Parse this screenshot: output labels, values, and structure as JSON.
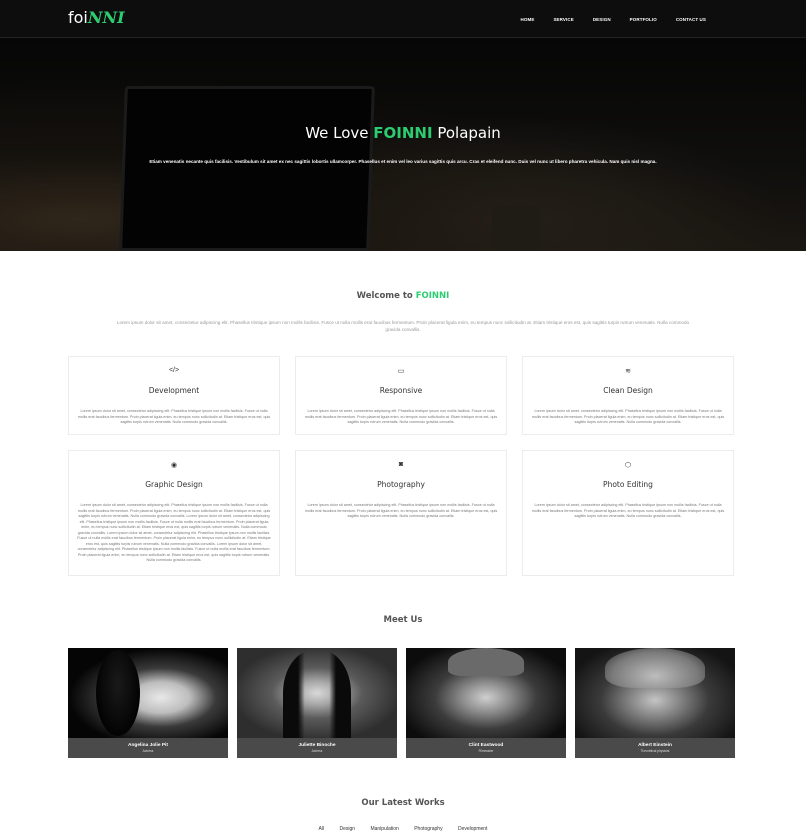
{
  "nav": {
    "logo_text": "foi",
    "logo_accent": "NNI",
    "items": [
      "HOME",
      "SERVICE",
      "DESIGN",
      "PORTFOLIO",
      "CONTACT US"
    ]
  },
  "hero": {
    "title_prefix": "We Love ",
    "title_brand": "FOINNI",
    "title_suffix": " Polapain",
    "subtitle": "Etiam venenatis necante quis facilisis. Vestibulum sit amet ex nec sagittis lobortis ullamcorper. Phasellus et enim vel leo varius sagittis quis arcu. Cras et eleifend nunc. Duis vel nunc ut libero pharetra vehicula. Nam quis nisl magna."
  },
  "welcome": {
    "title_prefix": "Welcome to ",
    "title_brand": "FOINNI",
    "text": "Lorem ipsum dolor sit amet, consectetur adipiscing elit. Phasellus tristique ipsum non mollis facilisis. Fusce ut nulla mollis erat faucibus fermentum. Proin placerat ligula enim, eu tempus nunc sollicitudin at. Etiam tristique eros est, quis sagittis turpis rutrum venenatis. Nulla commodo gravida convallis."
  },
  "services": [
    {
      "icon": "code-icon",
      "glyph": "</>",
      "title": "Development",
      "body": "Lorem ipsum dolor sit amet, consectetur adipiscing elit. Phasellus tristique ipsum non mollis facilisis. Fusce ut nulla mollis erat faucibus fermentum. Proin placerat ligula enim, eu tempus nunc sollicitudin at. Etiam tristique eros est, quis sagittis turpis rutrum venenatis. Nulla commodo gravida convallis."
    },
    {
      "icon": "monitor-icon",
      "glyph": "▭",
      "title": "Responsive",
      "body": "Lorem ipsum dolor sit amet, consectetur adipiscing elit. Phasellus tristique ipsum non mollis facilisis. Fusce ut nulla mollis erat faucibus fermentum. Proin placerat ligula enim, eu tempus nunc sollicitudin at. Etiam tristique eros est, quis sagittis turpis rutrum venenatis. Nulla commodo gravida convallis."
    },
    {
      "icon": "wifi-icon",
      "glyph": "≋",
      "title": "Clean Design",
      "body": "Lorem ipsum dolor sit amet, consectetur adipiscing elit. Phasellus tristique ipsum non mollis facilisis. Fusce ut nulla mollis erat faucibus fermentum. Proin placerat ligula enim, eu tempus nunc sollicitudin at. Etiam tristique eros est, quis sagittis turpis rutrum venenatis. Nulla commodo gravida convallis."
    },
    {
      "icon": "eye-icon",
      "glyph": "◉",
      "title": "Graphic Design",
      "body": "Lorem ipsum dolor sit amet, consectetur adipiscing elit. Phasellus tristique ipsum non mollis facilisis. Fusce ut nulla mollis erat faucibus fermentum. Proin placerat ligula enim, eu tempus nunc sollicitudin at. Etiam tristique eros est, quis sagittis turpis rutrum venenatis. Nulla commodo gravida convallis. Lorem ipsum dolor sit amet, consectetur adipiscing elit. Phasellus tristique ipsum non mollis facilisis. Fusce ut nulla mollis erat faucibus fermentum. Proin placerat ligula enim, eu tempus nunc sollicitudin at. Etiam tristique eros est, quis sagittis turpis rutrum venenatis. Nulla commodo gravida convallis. Lorem ipsum dolor sit amet, consectetur adipiscing elit. Phasellus tristique ipsum non mollis facilisis. Fusce ut nulla mollis erat faucibus fermentum. Proin placerat ligula enim, eu tempus nunc sollicitudin at. Etiam tristique eros est, quis sagittis turpis rutrum venenatis. Nulla commodo gravida convallis. Lorem ipsum dolor sit amet, consectetur adipiscing elit. Phasellus tristique ipsum non mollis facilisis. Fusce ut nulla mollis erat faucibus fermentum. Proin placerat ligula enim, eu tempus nunc sollicitudin at. Etiam tristique eros est, quis sagittis turpis rutrum venenatis. Nulla commodo gravida convallis."
    },
    {
      "icon": "camera-icon",
      "glyph": "◙",
      "title": "Photography",
      "body": "Lorem ipsum dolor sit amet, consectetur adipiscing elit. Phasellus tristique ipsum non mollis facilisis. Fusce ut nulla mollis erat faucibus fermentum. Proin placerat ligula enim, eu tempus nunc sollicitudin at. Etiam tristique eros est, quis sagittis turpis rutrum venenatis. Nulla commodo gravida convallis."
    },
    {
      "icon": "hexagon-icon",
      "glyph": "⬡",
      "title": "Photo Editing",
      "body": "Lorem ipsum dolor sit amet, consectetur adipiscing elit. Phasellus tristique ipsum non mollis facilisis. Fusce ut nulla mollis erat faucibus fermentum. Proin placerat ligula enim, eu tempus nunc sollicitudin at. Etiam tristique eros est, quis sagittis turpis rutrum venenatis. Nulla commodo gravida convallis."
    }
  ],
  "team": {
    "title": "Meet Us",
    "members": [
      {
        "name": "Angelina Jolie Pit",
        "role": "Actress"
      },
      {
        "name": "Juliette Binoche",
        "role": "Actress"
      },
      {
        "name": "Clint Eastwood",
        "role": "Filmmaker"
      },
      {
        "name": "Albert Einstein",
        "role": "Theoretical physicist"
      }
    ]
  },
  "works": {
    "title": "Our Latest Works",
    "filters": [
      "All",
      "Design",
      "Manipulation",
      "Photography",
      "Development"
    ]
  },
  "colors": {
    "accent": "#2ecc71",
    "nav_bg": "#0d0d0d",
    "caption_bg": "#4a4a4a"
  }
}
